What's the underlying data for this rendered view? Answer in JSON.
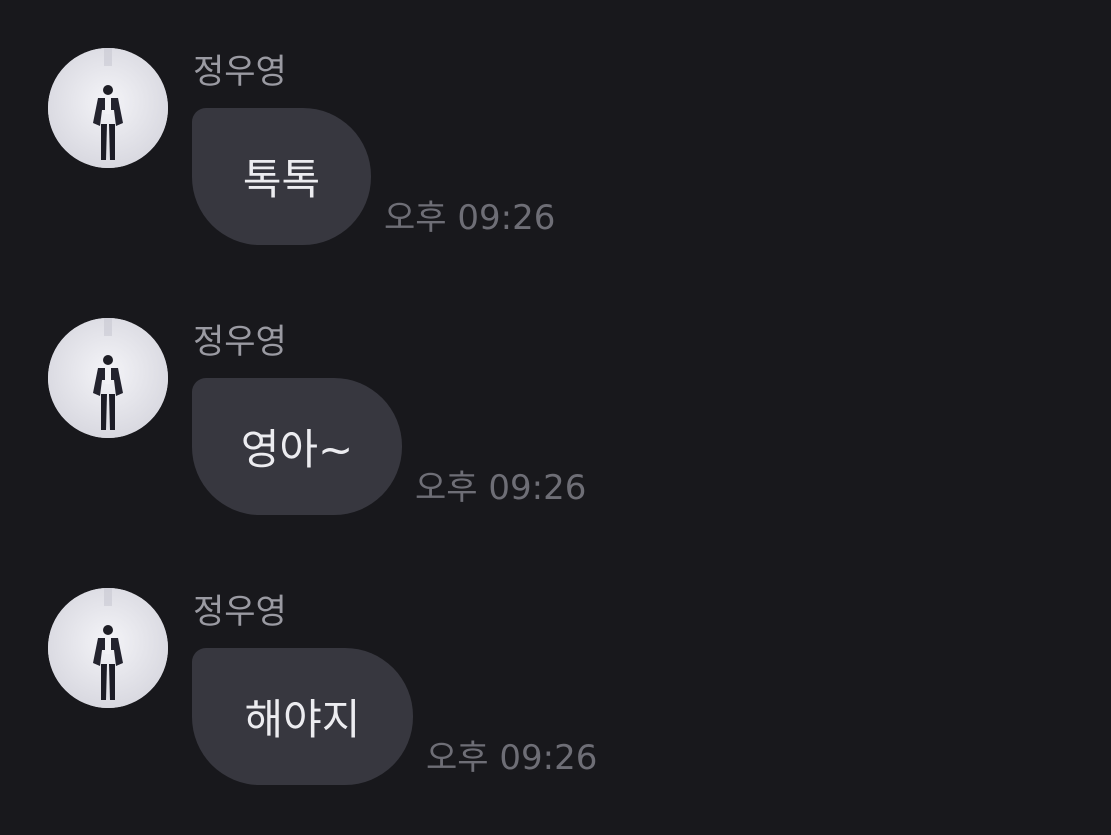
{
  "messages": [
    {
      "sender": "정우영",
      "text": "톡톡",
      "time": "오후 09:26"
    },
    {
      "sender": "정우영",
      "text": "영아~",
      "time": "오후 09:26"
    },
    {
      "sender": "정우영",
      "text": "해야지",
      "time": "오후 09:26"
    }
  ],
  "colors": {
    "background": "#18181c",
    "bubble": "#37373f",
    "sender_text": "#9a9aa2",
    "message_text": "#ececf0",
    "time_text": "#6e6e76"
  }
}
